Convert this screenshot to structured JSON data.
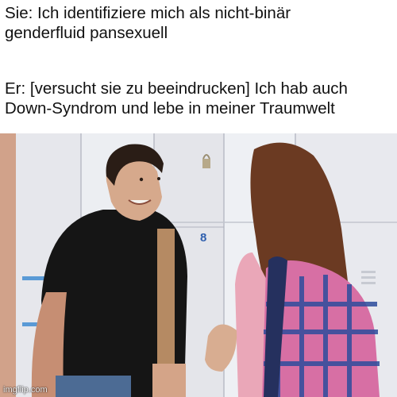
{
  "caption": {
    "line1": "Sie: Ich identifiziere mich als nicht-binär",
    "line2": "genderfluid pansexuell",
    "line3": "Er: [versucht sie zu beeindrucken] Ich hab auch",
    "line4": "Down-Syndrom und lebe in meiner Traumwelt"
  },
  "photo": {
    "locker_number": "8",
    "watermark": "imgflip.com"
  },
  "colors": {
    "locker": "#e8e9ee",
    "shirt": "#151515",
    "hair_girl": "#6b3a22",
    "backpack_pink": "#d76fa4",
    "backpack_blue": "#2d4c9c"
  }
}
